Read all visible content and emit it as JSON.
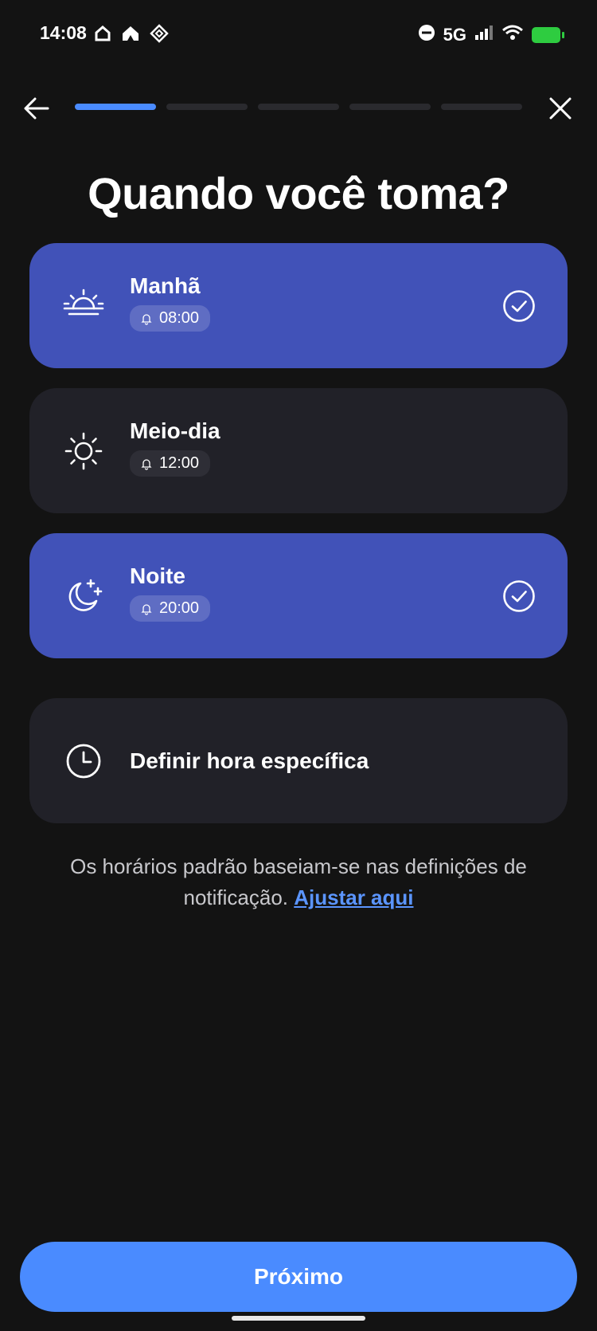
{
  "status_bar": {
    "time": "14:08",
    "network": "5G",
    "left_icons": [
      "home-icon",
      "home-alt-icon",
      "diamond-grid-icon"
    ],
    "right_icons": [
      "do-not-disturb-icon",
      "signal-icon",
      "wifi-icon",
      "battery-charging-icon"
    ]
  },
  "header": {
    "back_icon": "arrow-left-icon",
    "close_icon": "close-icon",
    "progress_step": 1,
    "progress_total": 5
  },
  "title": "Quando você toma?",
  "options": [
    {
      "label": "Manhã",
      "time": "08:00",
      "icon": "sunrise-icon",
      "selected": true
    },
    {
      "label": "Meio-dia",
      "time": "12:00",
      "icon": "sun-icon",
      "selected": false
    },
    {
      "label": "Noite",
      "time": "20:00",
      "icon": "moon-stars-icon",
      "selected": true
    },
    {
      "label": "Definir hora específica",
      "icon": "clock-icon",
      "selected": false
    }
  ],
  "footnote": {
    "text": "Os horários padrão baseiam-se nas definições de notificação.",
    "link": "Ajustar aqui"
  },
  "next_button": {
    "label": "Próximo"
  },
  "colors": {
    "background": "#131313",
    "card": "#212128",
    "card_selected": "#4152b8",
    "accent": "#4a8bff",
    "link": "#5b95ff"
  }
}
